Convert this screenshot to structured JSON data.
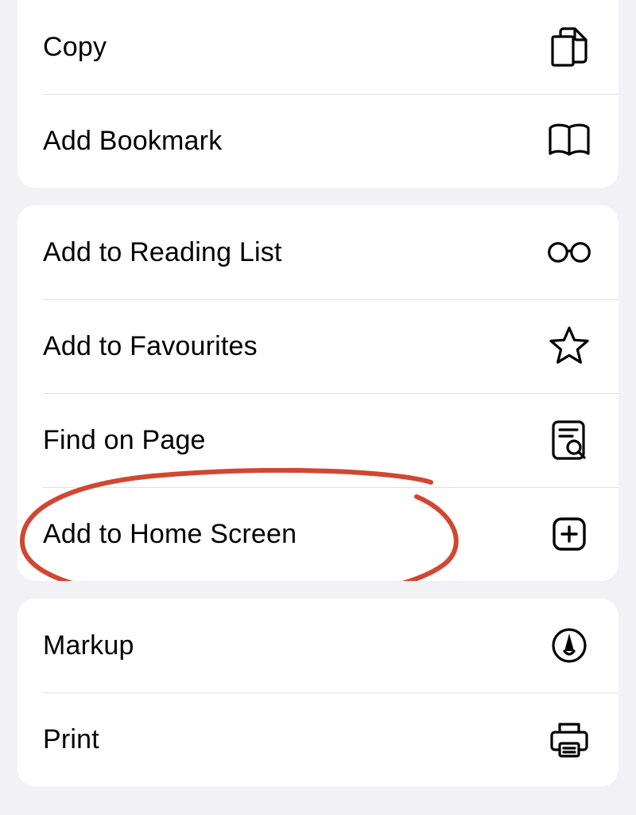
{
  "groups": [
    {
      "items": [
        {
          "key": "copy",
          "label": "Copy",
          "icon": "copy-icon"
        },
        {
          "key": "bookmark",
          "label": "Add Bookmark",
          "icon": "bookmark-icon"
        }
      ]
    },
    {
      "items": [
        {
          "key": "reading_list",
          "label": "Add to Reading List",
          "icon": "glasses-icon"
        },
        {
          "key": "favourites",
          "label": "Add to Favourites",
          "icon": "star-icon"
        },
        {
          "key": "find",
          "label": "Find on Page",
          "icon": "find-icon"
        },
        {
          "key": "home_screen",
          "label": "Add to Home Screen",
          "icon": "plus-square-icon",
          "annotated": true
        }
      ]
    },
    {
      "items": [
        {
          "key": "markup",
          "label": "Markup",
          "icon": "markup-icon"
        },
        {
          "key": "print",
          "label": "Print",
          "icon": "printer-icon"
        }
      ]
    }
  ],
  "annotation_color": "#d14732"
}
